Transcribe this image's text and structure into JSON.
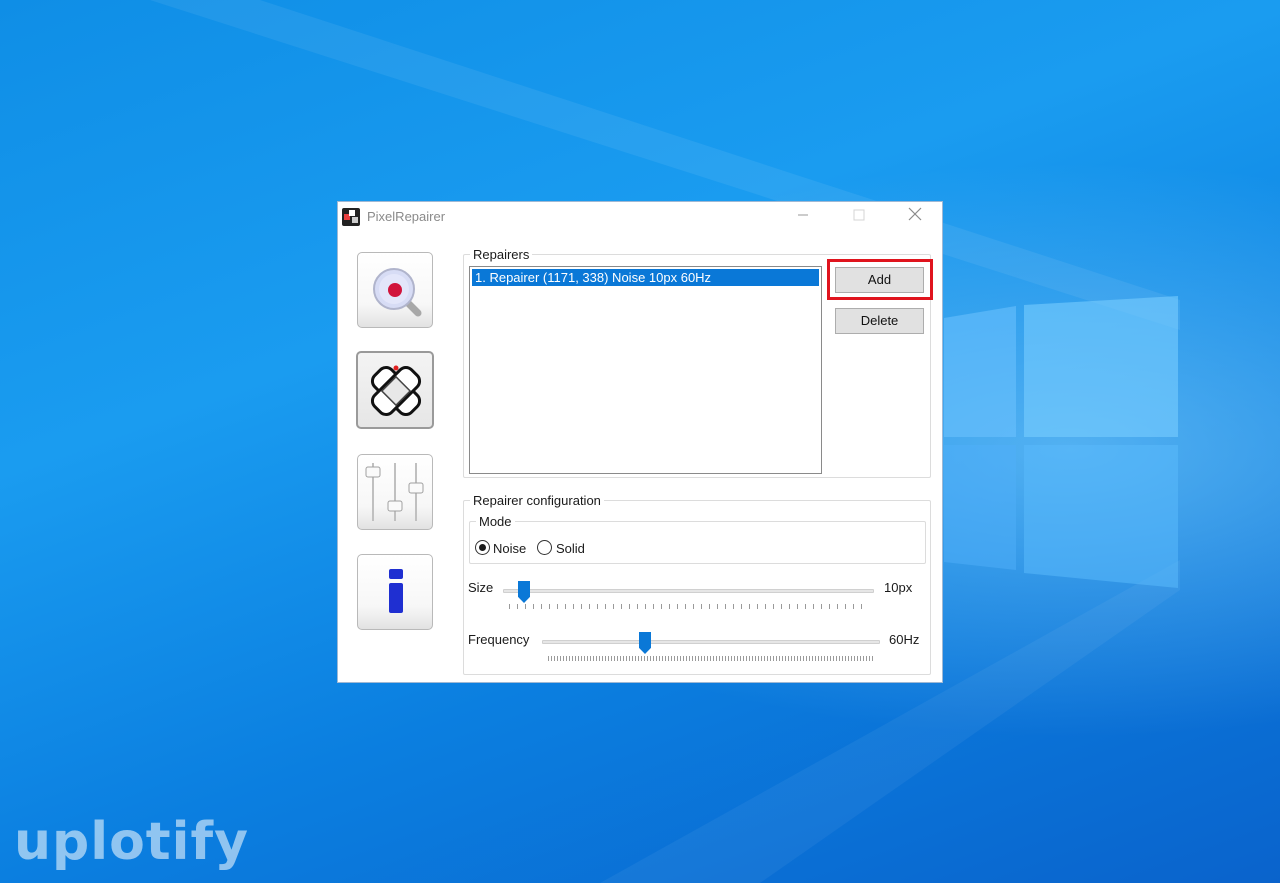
{
  "window": {
    "title": "PixelRepairer"
  },
  "sidebar": {
    "items": [
      {
        "icon": "magnifier-icon"
      },
      {
        "icon": "bandage-repair-icon"
      },
      {
        "icon": "sliders-icon"
      },
      {
        "icon": "info-icon"
      }
    ]
  },
  "repairers": {
    "legend": "Repairers",
    "items": [
      "1. Repairer (1171, 338) Noise 10px 60Hz"
    ],
    "add_label": "Add",
    "delete_label": "Delete"
  },
  "config": {
    "legend": "Repairer configuration",
    "mode_legend": "Mode",
    "mode_options": [
      "Noise",
      "Solid"
    ],
    "mode_selected": "Noise",
    "size_label": "Size",
    "size_value": "10px",
    "frequency_label": "Frequency",
    "frequency_value": "60Hz"
  },
  "watermark": {
    "text": "uplotify"
  },
  "colors": {
    "accent": "#0a78d7",
    "highlight": "#e0141e"
  }
}
